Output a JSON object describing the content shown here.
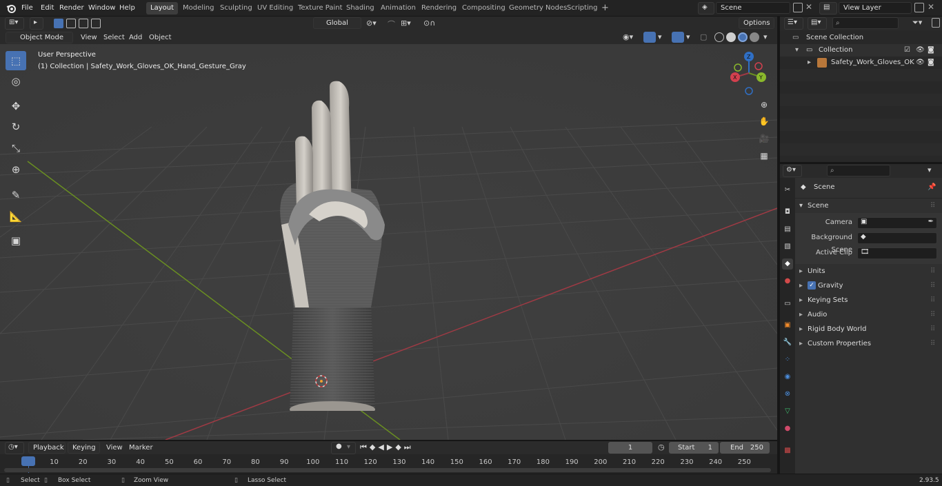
{
  "app": {
    "version": "2.93.5"
  },
  "topbar": {
    "menus": [
      "File",
      "Edit",
      "Render",
      "Window",
      "Help"
    ],
    "workspaces": [
      "Layout",
      "Modeling",
      "Sculpting",
      "UV Editing",
      "Texture Paint",
      "Shading",
      "Animation",
      "Rendering",
      "Compositing",
      "Geometry Nodes",
      "Scripting"
    ],
    "active_workspace": "Layout",
    "scene_name": "Scene",
    "view_layer_name": "View Layer"
  },
  "viewport_header": {
    "mode": "Object Mode",
    "menus": [
      "View",
      "Select",
      "Add",
      "Object"
    ],
    "transform_orientation": "Global",
    "options_label": "Options"
  },
  "viewport": {
    "view_name": "User Perspective",
    "collection_info": "(1) Collection | Safety_Work_Gloves_OK_Hand_Gesture_Gray",
    "gizmo_axes": [
      "X",
      "Y",
      "Z"
    ]
  },
  "outliner": {
    "root": "Scene Collection",
    "collection": "Collection",
    "object": "Safety_Work_Gloves_OK"
  },
  "properties": {
    "context_title": "Scene",
    "panel_title": "Scene",
    "fields": [
      {
        "label": "Camera"
      },
      {
        "label": "Background Scene"
      },
      {
        "label": "Active Clip"
      }
    ],
    "subpanels": [
      "Units",
      "Gravity",
      "Keying Sets",
      "Audio",
      "Rigid Body World",
      "Custom Properties"
    ],
    "gravity_checked": true
  },
  "timeline": {
    "menus": [
      "Playback",
      "Keying",
      "View",
      "Marker"
    ],
    "current_frame": "1",
    "start_label": "Start",
    "start_value": "1",
    "end_label": "End",
    "end_value": "250",
    "ticks": [
      "1",
      "10",
      "20",
      "30",
      "40",
      "50",
      "60",
      "70",
      "80",
      "90",
      "100",
      "110",
      "120",
      "130",
      "140",
      "150",
      "160",
      "170",
      "180",
      "190",
      "200",
      "210",
      "220",
      "230",
      "240",
      "250"
    ]
  },
  "statusbar": {
    "items": [
      "Select",
      "Box Select",
      "Zoom View",
      "Lasso Select"
    ]
  },
  "colors": {
    "accent": "#4772b3",
    "x_axis": "#a03a44",
    "y_axis": "#6a8f21",
    "z_axis": "#2f6fc5",
    "viewport_bg": "#3d3d3d"
  }
}
